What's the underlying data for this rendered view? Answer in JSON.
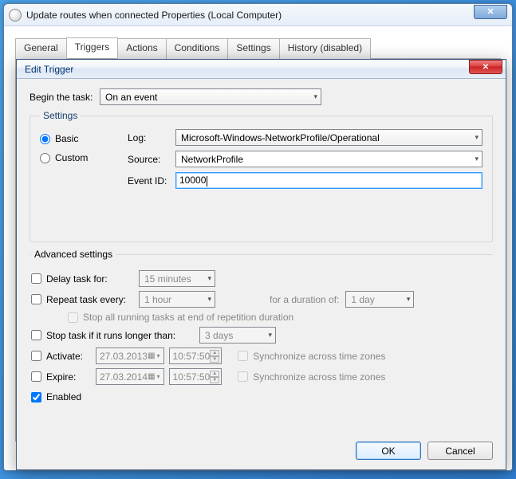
{
  "parentWindow": {
    "title": "Update routes when connected Properties (Local Computer)"
  },
  "tabs": {
    "general": "General",
    "triggers": "Triggers",
    "actions": "Actions",
    "conditions": "Conditions",
    "settings": "Settings",
    "history": "History (disabled)"
  },
  "dialog": {
    "title": "Edit Trigger",
    "beginLabel": "Begin the task:",
    "beginValue": "On an event",
    "settingsLegend": "Settings",
    "basic": "Basic",
    "custom": "Custom",
    "logLabel": "Log:",
    "logValue": "Microsoft-Windows-NetworkProfile/Operational",
    "sourceLabel": "Source:",
    "sourceValue": "NetworkProfile",
    "eventIdLabel": "Event ID:",
    "eventIdValue": "10000",
    "advLegend": "Advanced settings",
    "delayLabel": "Delay task for:",
    "delayValue": "15 minutes",
    "repeatLabel": "Repeat task every:",
    "repeatValue": "1 hour",
    "durationLabel": "for a duration of:",
    "durationValue": "1 day",
    "stopAllLabel": "Stop all running tasks at end of repetition duration",
    "stopIfLabel": "Stop task if it runs longer than:",
    "stopIfValue": "3 days",
    "activateLabel": "Activate:",
    "activateDate": "27.03.2013",
    "activateTime": "10:57:50",
    "expireLabel": "Expire:",
    "expireDate": "27.03.2014",
    "expireTime": "10:57:50",
    "syncLabel": "Synchronize across time zones",
    "enabledLabel": "Enabled",
    "ok": "OK",
    "cancel": "Cancel"
  }
}
